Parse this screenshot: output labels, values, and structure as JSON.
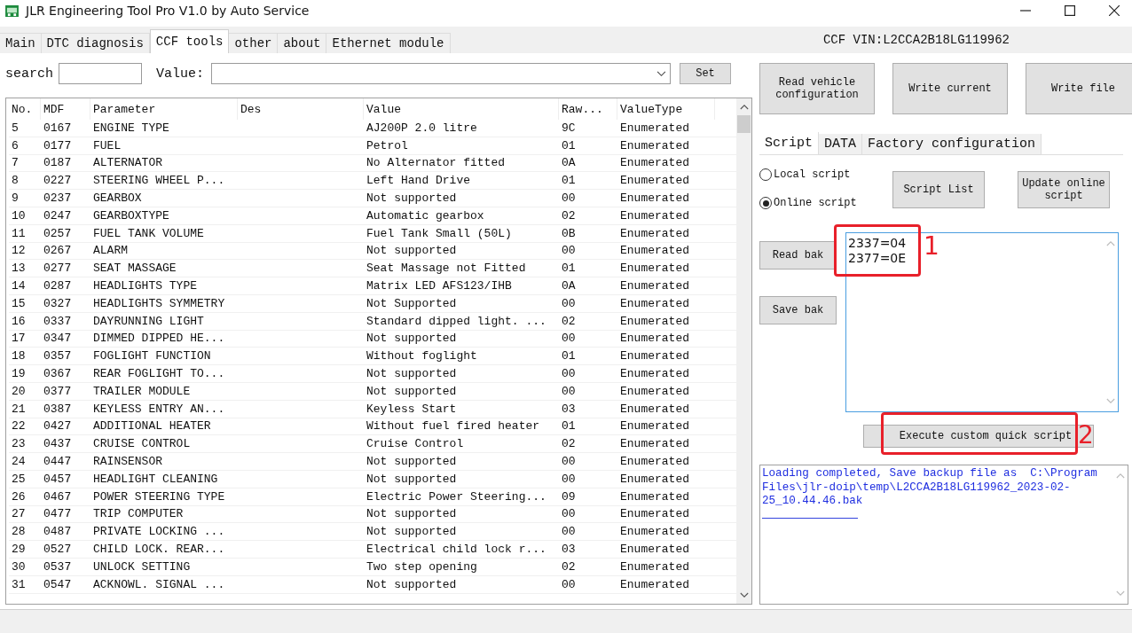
{
  "window": {
    "title": "JLR Engineering Tool Pro V1.0 by Auto Service"
  },
  "tabs": [
    {
      "label": "Main",
      "selected": false
    },
    {
      "label": "DTC diagnosis",
      "selected": false
    },
    {
      "label": "CCF tools",
      "selected": true
    },
    {
      "label": "other",
      "selected": false
    },
    {
      "label": "about",
      "selected": false
    },
    {
      "label": "Ethernet module",
      "selected": false
    }
  ],
  "vin_label": "CCF VIN:L2CCA2B18LG119962",
  "search": {
    "label": "search"
  },
  "value_field": {
    "label": "Value:"
  },
  "set_button": "Set",
  "table": {
    "columns": [
      "No.",
      "MDF",
      "Parameter",
      "Des",
      "Value",
      "Raw...",
      "ValueType"
    ],
    "rows": [
      [
        "5",
        "0167",
        "ENGINE TYPE",
        "",
        "AJ200P 2.0 litre",
        "9C",
        "Enumerated"
      ],
      [
        "6",
        "0177",
        "FUEL",
        "",
        "Petrol",
        "01",
        "Enumerated"
      ],
      [
        "7",
        "0187",
        "ALTERNATOR",
        "",
        "No Alternator fitted",
        "0A",
        "Enumerated"
      ],
      [
        "8",
        "0227",
        "STEERING WHEEL P...",
        "",
        "Left Hand Drive",
        "01",
        "Enumerated"
      ],
      [
        "9",
        "0237",
        "GEARBOX",
        "",
        "Not supported",
        "00",
        "Enumerated"
      ],
      [
        "10",
        "0247",
        "GEARBOXTYPE",
        "",
        "Automatic gearbox",
        "02",
        "Enumerated"
      ],
      [
        "11",
        "0257",
        "FUEL TANK VOLUME",
        "",
        "Fuel Tank Small (50L)",
        "0B",
        "Enumerated"
      ],
      [
        "12",
        "0267",
        "ALARM",
        "",
        "Not supported",
        "00",
        "Enumerated"
      ],
      [
        "13",
        "0277",
        "SEAT MASSAGE",
        "",
        "Seat Massage not Fitted",
        "01",
        "Enumerated"
      ],
      [
        "14",
        "0287",
        "HEADLIGHTS TYPE",
        "",
        "Matrix LED AFS123/IHB",
        "0A",
        "Enumerated"
      ],
      [
        "15",
        "0327",
        "HEADLIGHTS SYMMETRY",
        "",
        "Not Supported",
        "00",
        "Enumerated"
      ],
      [
        "16",
        "0337",
        "DAYRUNNING LIGHT",
        "",
        "Standard dipped light. ...",
        "02",
        "Enumerated"
      ],
      [
        "17",
        "0347",
        "DIMMED DIPPED HE...",
        "",
        "Not supported",
        "00",
        "Enumerated"
      ],
      [
        "18",
        "0357",
        "FOGLIGHT FUNCTION",
        "",
        "Without foglight",
        "01",
        "Enumerated"
      ],
      [
        "19",
        "0367",
        "REAR FOGLIGHT TO...",
        "",
        "Not supported",
        "00",
        "Enumerated"
      ],
      [
        "20",
        "0377",
        "TRAILER MODULE",
        "",
        "Not supported",
        "00",
        "Enumerated"
      ],
      [
        "21",
        "0387",
        "KEYLESS ENTRY AN...",
        "",
        "Keyless Start",
        "03",
        "Enumerated"
      ],
      [
        "22",
        "0427",
        "ADDITIONAL HEATER",
        "",
        "Without fuel fired heater",
        "01",
        "Enumerated"
      ],
      [
        "23",
        "0437",
        "CRUISE CONTROL",
        "",
        "Cruise Control",
        "02",
        "Enumerated"
      ],
      [
        "24",
        "0447",
        "RAINSENSOR",
        "",
        "Not supported",
        "00",
        "Enumerated"
      ],
      [
        "25",
        "0457",
        "HEADLIGHT CLEANING",
        "",
        "Not supported",
        "00",
        "Enumerated"
      ],
      [
        "26",
        "0467",
        "POWER STEERING TYPE",
        "",
        "Electric Power Steering...",
        "09",
        "Enumerated"
      ],
      [
        "27",
        "0477",
        "TRIP COMPUTER",
        "",
        "Not supported",
        "00",
        "Enumerated"
      ],
      [
        "28",
        "0487",
        "PRIVATE LOCKING ...",
        "",
        "Not supported",
        "00",
        "Enumerated"
      ],
      [
        "29",
        "0527",
        "CHILD LOCK. REAR...",
        "",
        "Electrical child lock r...",
        "03",
        "Enumerated"
      ],
      [
        "30",
        "0537",
        "UNLOCK SETTING",
        "",
        "Two step opening",
        "02",
        "Enumerated"
      ],
      [
        "31",
        "0547",
        "ACKNOWL. SIGNAL ...",
        "",
        "Not supported",
        "00",
        "Enumerated"
      ]
    ]
  },
  "action_buttons": [
    "Read vehicle configuration",
    "Write current",
    "Write file"
  ],
  "sub_tabs": [
    {
      "label": "Script",
      "selected": true
    },
    {
      "label": "DATA",
      "selected": false
    },
    {
      "label": "Factory configuration",
      "selected": false
    }
  ],
  "script_sources": [
    {
      "label": "Local script",
      "selected": false
    },
    {
      "label": "Online script",
      "selected": true
    }
  ],
  "script_buttons": [
    "Script List",
    "Update online script"
  ],
  "backup_buttons": [
    "Read bak",
    "Save bak"
  ],
  "script_text": [
    "2337=04",
    "2377=0E"
  ],
  "execute_button": "Execute custom quick script",
  "log": "Loading completed, Save backup file as  C:\\Program Files\\jlr-doip\\temp\\L2CCA2B18LG119962_2023-02-25_10.44.46.bak",
  "annotations": [
    {
      "label": "1"
    },
    {
      "label": "2"
    }
  ]
}
